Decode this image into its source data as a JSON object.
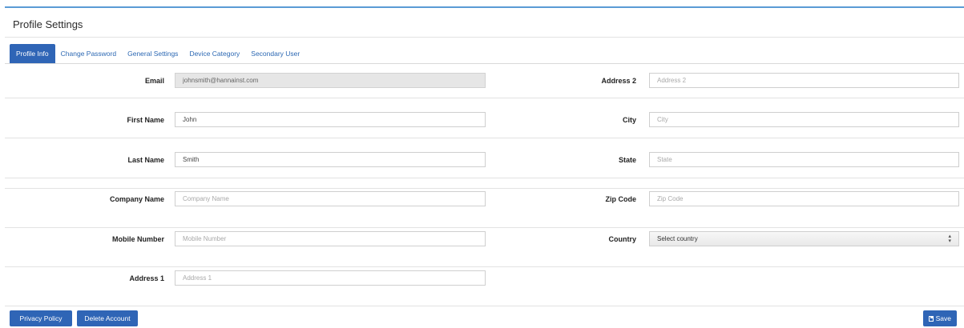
{
  "panel": {
    "title": "Profile Settings"
  },
  "tabs": [
    {
      "label": "Profile Info",
      "active": true
    },
    {
      "label": "Change Password",
      "active": false
    },
    {
      "label": "General Settings",
      "active": false
    },
    {
      "label": "Device Category",
      "active": false
    },
    {
      "label": "Secondary User",
      "active": false
    }
  ],
  "form": {
    "email": {
      "label": "Email",
      "value": "johnsmith@hannainst.com"
    },
    "first_name": {
      "label": "First Name",
      "value": "John"
    },
    "last_name": {
      "label": "Last Name",
      "value": "Smith"
    },
    "company_name": {
      "label": "Company Name",
      "value": "",
      "placeholder": "Company Name"
    },
    "mobile_number": {
      "label": "Mobile Number",
      "value": "",
      "placeholder": "Mobile Number"
    },
    "address1": {
      "label": "Address 1",
      "value": "",
      "placeholder": "Address 1"
    },
    "address2": {
      "label": "Address 2",
      "value": "",
      "placeholder": "Address 2"
    },
    "city": {
      "label": "City",
      "value": "",
      "placeholder": "City"
    },
    "state": {
      "label": "State",
      "value": "",
      "placeholder": "State"
    },
    "zip_code": {
      "label": "Zip Code",
      "value": "",
      "placeholder": "Zip Code"
    },
    "country": {
      "label": "Country",
      "selected": "Select country"
    }
  },
  "footer": {
    "privacy_label": "Privacy Policy",
    "delete_label": "Delete Account",
    "save_label": "Save"
  },
  "colors": {
    "primary": "#2f65b6",
    "accent_top": "#5a9bd5",
    "readonly_bg": "#e6e6e6"
  },
  "icons": {
    "save": "floppy-disk-icon",
    "select": "up-down-arrows-icon"
  }
}
